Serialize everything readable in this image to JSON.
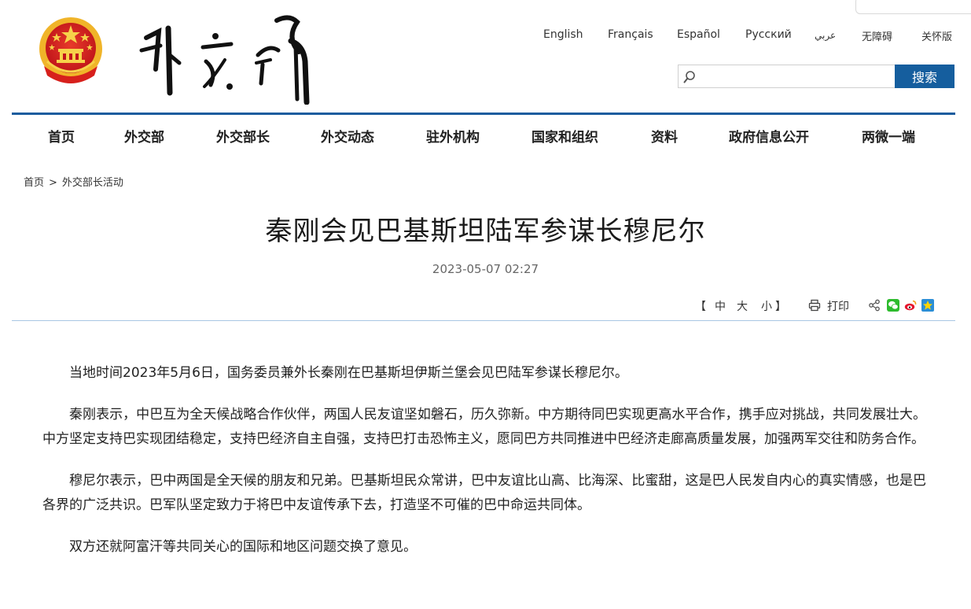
{
  "header": {
    "languages": [
      "English",
      "Français",
      "Español",
      "Русский",
      "عربي",
      "无障碍",
      "关怀版"
    ],
    "search": {
      "placeholder": "",
      "button_label": "搜索"
    }
  },
  "nav": {
    "items": [
      "首页",
      "外交部",
      "外交部长",
      "外交动态",
      "驻外机构",
      "国家和组织",
      "资料",
      "政府信息公开",
      "两微一端"
    ]
  },
  "breadcrumb": {
    "home": "首页",
    "separator": ">",
    "current": "外交部长活动"
  },
  "article": {
    "title": "秦刚会见巴基斯坦陆军参谋长穆尼尔",
    "date": "2023-05-07 02:27",
    "font_size": {
      "open": "【",
      "large": "中",
      "medium": "大",
      "small": "小",
      "close": "】"
    },
    "print_label": "打印",
    "paragraphs": [
      "当地时间2023年5月6日，国务委员兼外长秦刚在巴基斯坦伊斯兰堡会见巴陆军参谋长穆尼尔。",
      "秦刚表示，中巴互为全天候战略合作伙伴，两国人民友谊坚如磐石，历久弥新。中方期待同巴实现更高水平合作，携手应对挑战，共同发展壮大。中方坚定支持巴实现团结稳定，支持巴经济自主自强，支持巴打击恐怖主义，愿同巴方共同推进中巴经济走廊高质量发展，加强两军交往和防务合作。",
      "穆尼尔表示，巴中两国是全天候的朋友和兄弟。巴基斯坦民众常讲，巴中友谊比山高、比海深、比蜜甜，这是巴人民发自内心的真实情感，也是巴各界的广泛共识。巴军队坚定致力于将巴中友谊传承下去，打造坚不可催的巴中命运共同体。",
      "双方还就阿富汗等共同关心的国际和地区问题交换了意见。"
    ]
  },
  "colors": {
    "nav_blue": "#1b5c9e",
    "search_button": "#155e9e",
    "emblem_red": "#d7201c",
    "emblem_gold": "#f4c430"
  },
  "icons": {
    "emblem": "national-emblem-icon",
    "logo": "calligraphy-logo",
    "search": "magnifier-icon",
    "print": "printer-icon",
    "share": "share-icon",
    "wechat": "wechat-icon",
    "weibo": "weibo-icon",
    "qzone": "qzone-icon"
  }
}
